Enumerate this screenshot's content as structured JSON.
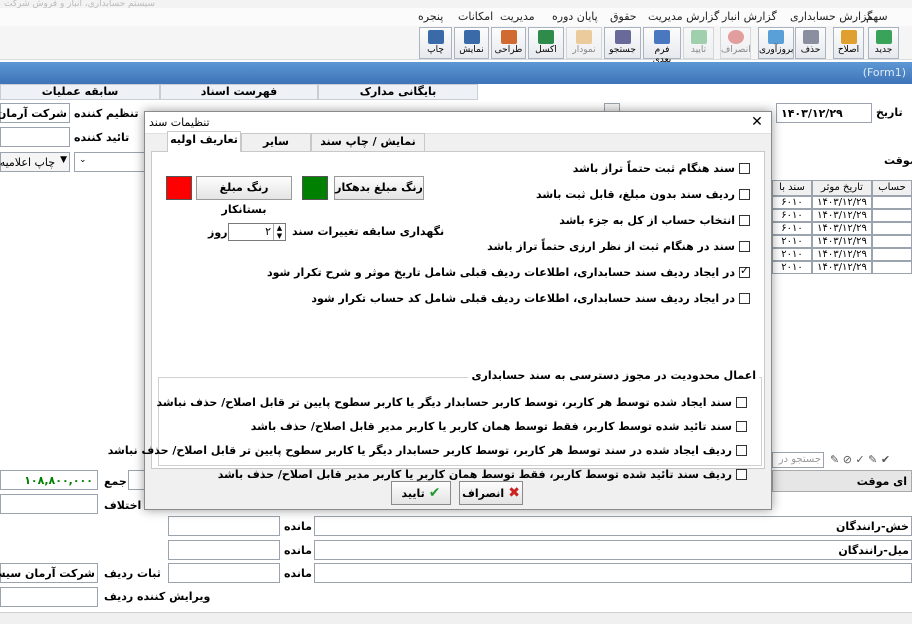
{
  "app": {
    "title": "سیستم حسابداری، انبار و فروش شرکت"
  },
  "menu": [
    "سهم",
    "گزارش حسابداری",
    "گزارش انبار",
    "گزارش مدیریت",
    "حقوق",
    "پایان دوره",
    "مدیریت",
    "امکانات",
    "پنجره"
  ],
  "toolbar": [
    {
      "label": "جدید",
      "color": "#3aa35a",
      "enabled": true
    },
    {
      "label": "اصلاح",
      "color": "#e0a030",
      "enabled": true
    },
    {
      "label": "حذف",
      "color": "#8a8fa0",
      "enabled": true
    },
    {
      "label": "بروزآوری",
      "color": "#5aa0d8",
      "enabled": true
    },
    {
      "label": "انصراف",
      "color": "#cc3333",
      "enabled": false
    },
    {
      "label": "تایید",
      "color": "#3aa35a",
      "enabled": false
    },
    {
      "label": "فرم بعدی",
      "color": "#4a78c0",
      "enabled": true
    },
    {
      "label": "جستجو",
      "color": "#6a6a9a",
      "enabled": true
    },
    {
      "label": "نمودار",
      "color": "#e09a30",
      "enabled": false
    },
    {
      "label": "اکسل",
      "color": "#2e8b4a",
      "enabled": true
    },
    {
      "label": "طراحی",
      "color": "#d06a30",
      "enabled": true
    },
    {
      "label": "نمایش",
      "color": "#3a6aa8",
      "enabled": true
    },
    {
      "label": "چاپ",
      "color": "#3a6aa8",
      "enabled": true
    }
  ],
  "form_label": "(Form1)",
  "back_tabs": [
    "بایگانی مدارک",
    "فهرست اسناد",
    "سابقه عملیات"
  ],
  "back": {
    "date_label": "تاریخ",
    "date_value": "۱۴۰۳/۱۲/۲۹",
    "organizer_label": "تنظیم کننده",
    "organizer_value": "شرکت آرمان سی",
    "approver_label": "تائید کننده",
    "print_label": "چاپ اعلامیه",
    "temp_label": "موقت",
    "grid_headers": [
      "حساب",
      "تاریخ موثر",
      "سند با"
    ],
    "grid_rows": [
      [
        "۶۰۱۰",
        "۱۴۰۳/۱۲/۲۹"
      ],
      [
        "۶۰۱۰",
        "۱۴۰۳/۱۲/۲۹"
      ],
      [
        "۶۰۱۰",
        "۱۴۰۳/۱۲/۲۹"
      ],
      [
        "۲۰۱۰",
        "۱۴۰۳/۱۲/۲۹"
      ],
      [
        "۲۰۱۰",
        "۱۴۰۳/۱۲/۲۹"
      ],
      [
        "۲۰۱۰",
        "۱۴۰۳/۱۲/۲۹"
      ]
    ],
    "search_placeholder": "جستجو در",
    "temp_label2": "ای موقت",
    "sum_label": "جمع",
    "sum_value": "۱۰۸,۸۰۰,۰۰۰",
    "diff_label": "اختلاف",
    "remain_label": "مانده",
    "row1_text": "خش-رانندگان",
    "row2_text": "میل-رانندگان",
    "recorder_label": "ثبات ردیف",
    "recorder_value": "شرکت آرمان سیستم و",
    "editor_label": "ویرایش کننده ردیف"
  },
  "dialog": {
    "title": "تنظیمات سند",
    "close": "✕",
    "tabs": [
      "تعاریف اولیه",
      "سایر",
      "نمایش / چاپ سند"
    ],
    "checks": [
      {
        "label": "سند هنگام ثبت حتماً تراز باشد",
        "checked": false
      },
      {
        "label": "ردیف سند بدون مبلغ، قابل ثبت باشد",
        "checked": false
      },
      {
        "label": "انتخاب حساب از کل به جزء باشد",
        "checked": false
      },
      {
        "label": "سند در هنگام ثبت از نظر ارزی حتماً تراز باشد",
        "checked": false
      },
      {
        "label": "در ایجاد ردیف سند حسابداری، اطلاعات ردیف قبلی شامل تاریخ موثر و شرح تکرار شود",
        "checked": true
      },
      {
        "label": "در ایجاد ردیف سند حسابداری، اطلاعات ردیف قبلی شامل کد حساب تکرار شود",
        "checked": false
      }
    ],
    "debit_color_btn": "رنگ مبلغ بدهکار",
    "credit_color_btn": "رنگ مبلغ بستانکار",
    "debit_color": "#008000",
    "credit_color": "#ff0000",
    "history_label": "نگهداری سابقه تغییرات سند",
    "history_value": "۲",
    "history_unit": "روز",
    "group_title": "اعمال محدودیت در مجوز دسترسی به سند حسابداری",
    "group_checks": [
      {
        "label": "سند ایجاد شده توسط هر کاربر، توسط کاربر حسابدار دیگر یا کاربر سطوح پایین تر قابل اصلاح/ حذف نباشد",
        "checked": false
      },
      {
        "label": "سند تائید شده توسط کاربر، فقط توسط همان کاربر یا کاربر مدیر قابل اصلاح/ حذف باشد",
        "checked": false
      },
      {
        "label": "ردیف ایجاد شده در سند توسط هر کاربر، توسط کاربر حسابدار دیگر یا کاربر سطوح پایین تر قابل اصلاح/ حذف نباشد",
        "checked": false
      },
      {
        "label": "ردیف سند تائید شده توسط کاربر، فقط توسط همان کاربر یا کاربر مدیر قابل اصلاح/ حذف باشد",
        "checked": false
      }
    ],
    "cancel_btn": "انصراف",
    "ok_btn": "تایید"
  }
}
